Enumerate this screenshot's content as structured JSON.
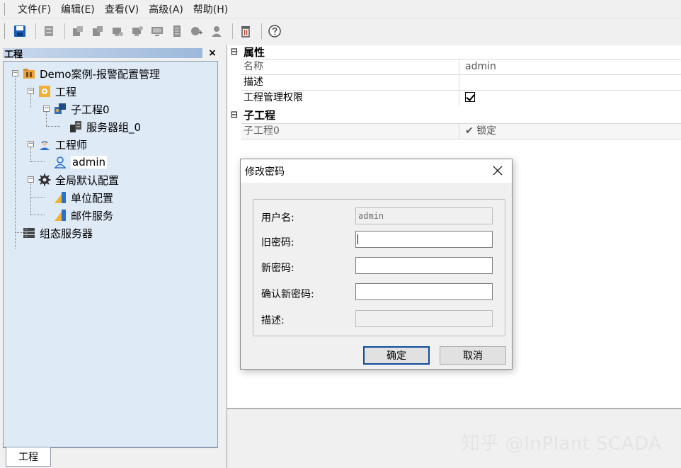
{
  "menu": {
    "items": [
      "文件(F)",
      "编辑(E)",
      "查看(V)",
      "高级(A)",
      "帮助(H)"
    ]
  },
  "toolbar": {
    "buttons": [
      "save-icon",
      "server-icon",
      "add-node-icon",
      "add-node-icon",
      "add-node-icon",
      "add-node-icon",
      "monitor-icon",
      "document-icon",
      "add-group-icon",
      "user-icon",
      "delete-icon",
      "help-icon"
    ]
  },
  "project_panel": {
    "title": "工程",
    "close": "×",
    "tree": {
      "root": "Demo案例-报警配置管理",
      "project": "工程",
      "sub_project": "子工程0",
      "server_group": "服务器组_0",
      "engineer": "工程师",
      "admin": "admin",
      "global_config": "全局默认配置",
      "unit_config": "单位配置",
      "mail_service": "邮件服务",
      "config_server": "组态服务器"
    },
    "bottom_tab": "工程"
  },
  "property_grid": {
    "attributes": {
      "category": "属性",
      "toggle": "⊟",
      "rows": {
        "name_key": "名称",
        "name_value": "admin",
        "desc_key": "描述",
        "desc_value": "",
        "perm_key": "工程管理权限"
      }
    },
    "sub_projects": {
      "category": "子工程",
      "toggle": "⊟",
      "row_key": "子工程0",
      "row_value": "✔ 锁定"
    }
  },
  "dialog": {
    "title": "修改密码",
    "username_label": "用户名:",
    "username_value": "admin",
    "old_password_label": "旧密码:",
    "new_password_label": "新密码:",
    "confirm_password_label": "确认新密码:",
    "description_label": "描述:",
    "ok_label": "确定",
    "cancel_label": "取消"
  },
  "watermark": "知乎 @InPlant SCADA"
}
